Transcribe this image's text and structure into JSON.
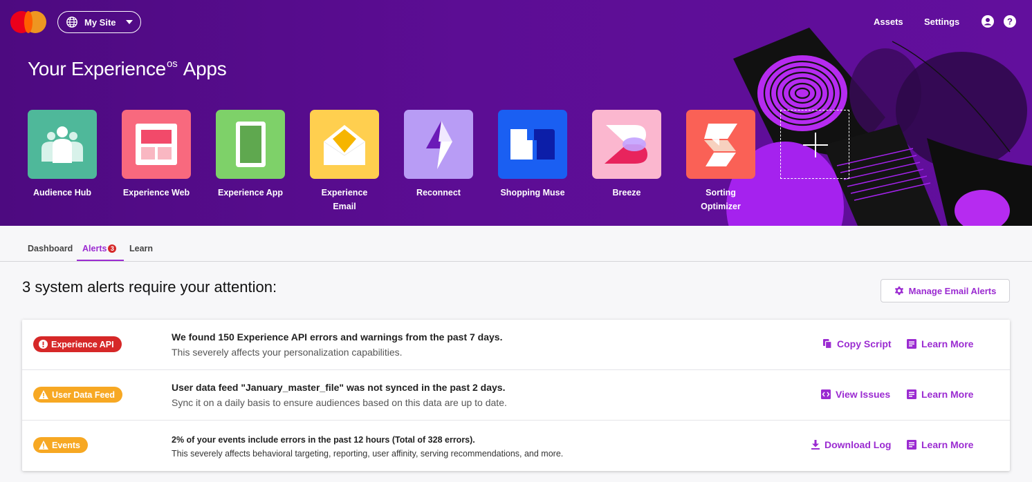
{
  "topbar": {
    "site_label": "My Site",
    "nav": {
      "assets": "Assets",
      "settings": "Settings"
    },
    "icons": {
      "site": "globe-icon",
      "account": "account-icon",
      "help": "help-icon"
    }
  },
  "hero": {
    "title_main": "Your Experience",
    "title_sup": "OS",
    "title_end": "Apps"
  },
  "apps": [
    {
      "label": "Audience Hub",
      "color": "#4fb89a"
    },
    {
      "label": "Experience Web",
      "color": "#f8697e"
    },
    {
      "label": "Experience App",
      "color": "#7ed169"
    },
    {
      "label": "Experience Email",
      "color": "#ffcf4f"
    },
    {
      "label": "Reconnect",
      "color": "#b89cf5"
    },
    {
      "label": "Shopping Muse",
      "color": "#1a5ff2"
    },
    {
      "label": "Breeze",
      "color": "#fbb7cf"
    },
    {
      "label": "Sorting Optimizer",
      "color": "#fa6156"
    }
  ],
  "tabs": {
    "dashboard": "Dashboard",
    "alerts": "Alerts",
    "alerts_count": "3",
    "learn": "Learn"
  },
  "alerts_section": {
    "title": "3 system alerts require your attention:",
    "manage_button": "Manage Email Alerts",
    "items": [
      {
        "badge": "Experience API",
        "title": "We found 150 Experience API errors and warnings from the past 7 days.",
        "subtitle": "This severely affects your personalization capabilities.",
        "action": "Copy Script",
        "learn": "Learn More"
      },
      {
        "badge": "User Data Feed",
        "title": "User data feed \"January_master_file\" was not synced in the past 2 days.",
        "subtitle": "Sync it on a daily basis to ensure audiences based on this data are up to date.",
        "action": "View Issues",
        "learn": "Learn More"
      },
      {
        "badge": "Events",
        "title": "2% of your events include errors in the past 12 hours (Total of 328 errors).",
        "subtitle": "This severely affects behavioral targeting, reporting, user affinity, serving recommendations, and more.",
        "action": "Download Log",
        "learn": "Learn More"
      }
    ]
  },
  "colors": {
    "brand_purple": "#9b2bd1",
    "hero_bg": "#5c0d94",
    "alert_red": "#d62828",
    "alert_amber": "#f7a823"
  }
}
